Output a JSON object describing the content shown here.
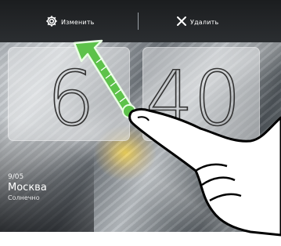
{
  "topbar": {
    "edit_label": "Изменить",
    "delete_label": "Удалить"
  },
  "clock": {
    "hour": "6",
    "minutes": "40"
  },
  "weather_widget": {
    "date": "9/05",
    "city": "Москва",
    "condition": "Солнечно"
  },
  "icons": [
    "gear-icon",
    "close-icon",
    "swipe-up-arrow-icon",
    "hand-gesture-icon"
  ],
  "colors": {
    "arrow_green": "#5dc24a",
    "topbar": "#222528"
  }
}
